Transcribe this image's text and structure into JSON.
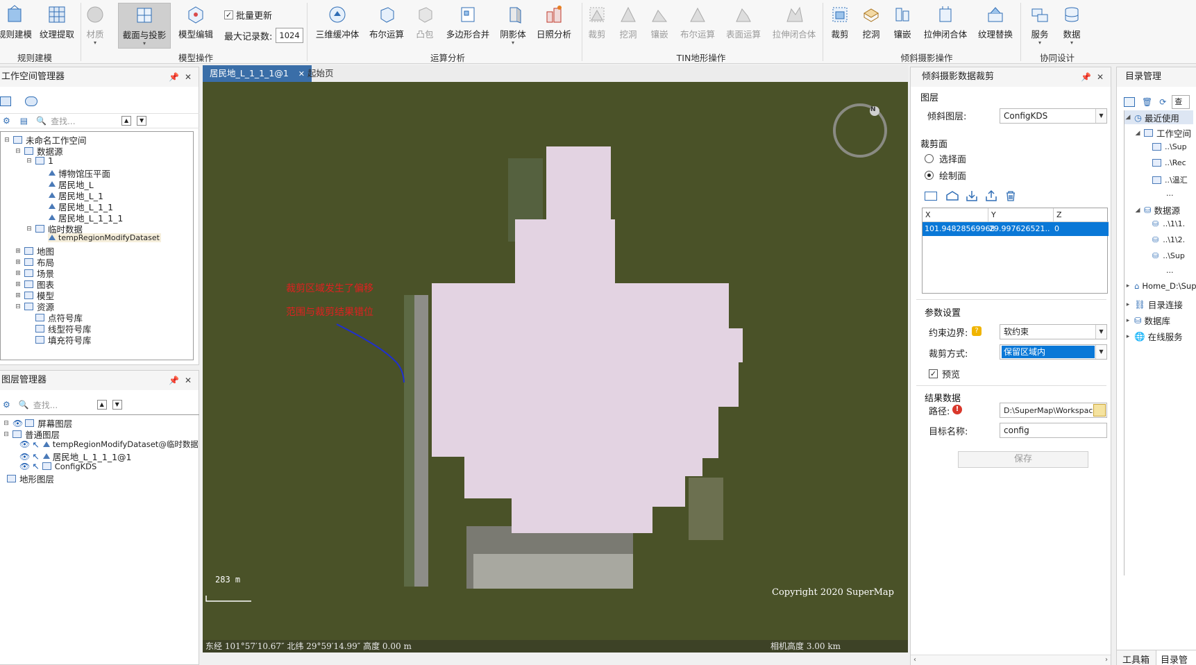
{
  "ribbon": {
    "buttons": [
      {
        "id": "rule-model",
        "label": "规则建模",
        "dropdown": false,
        "disabled": false,
        "icon": "building-icon"
      },
      {
        "id": "texture-extract",
        "label": "纹理提取",
        "dropdown": false,
        "disabled": false,
        "icon": "texture-icon"
      },
      {
        "id": "material",
        "label": "材质",
        "dropdown": true,
        "disabled": true,
        "icon": "sphere-icon"
      },
      {
        "id": "section-projection",
        "label": "截面与投影",
        "dropdown": true,
        "disabled": false,
        "icon": "section-icon"
      },
      {
        "id": "model-edit",
        "label": "模型编辑",
        "dropdown": false,
        "disabled": false,
        "icon": "model-edit-icon"
      },
      {
        "id": "buffer3d",
        "label": "三维缓冲体",
        "dropdown": false,
        "disabled": false,
        "icon": "buffer-icon"
      },
      {
        "id": "boolean",
        "label": "布尔运算",
        "dropdown": false,
        "disabled": false,
        "icon": "boolean-icon"
      },
      {
        "id": "convex",
        "label": "凸包",
        "dropdown": false,
        "disabled": true,
        "icon": "convex-icon"
      },
      {
        "id": "polygon-merge",
        "label": "多边形合并",
        "dropdown": false,
        "disabled": false,
        "icon": "polygon-merge-icon"
      },
      {
        "id": "shadow",
        "label": "阴影体",
        "dropdown": true,
        "disabled": false,
        "icon": "shadow-icon"
      },
      {
        "id": "sunlight",
        "label": "日照分析",
        "dropdown": false,
        "disabled": false,
        "icon": "sunlight-icon"
      },
      {
        "id": "tin-clip",
        "label": "裁剪",
        "dropdown": false,
        "disabled": true,
        "icon": "tin-clip-icon"
      },
      {
        "id": "tin-dig",
        "label": "挖洞",
        "dropdown": false,
        "disabled": true,
        "icon": "tin-dig-icon"
      },
      {
        "id": "tin-inlay",
        "label": "镶嵌",
        "dropdown": false,
        "disabled": true,
        "icon": "tin-inlay-icon"
      },
      {
        "id": "tin-boolean",
        "label": "布尔运算",
        "dropdown": false,
        "disabled": true,
        "icon": "tin-boolean-icon"
      },
      {
        "id": "tin-surface",
        "label": "表面运算",
        "dropdown": false,
        "disabled": true,
        "icon": "tin-surface-icon"
      },
      {
        "id": "tin-extrude",
        "label": "拉伸闭合体",
        "dropdown": false,
        "disabled": true,
        "icon": "tin-extrude-icon"
      },
      {
        "id": "oblique-clip",
        "label": "裁剪",
        "dropdown": false,
        "disabled": false,
        "icon": "oblique-clip-icon"
      },
      {
        "id": "oblique-dig",
        "label": "挖洞",
        "dropdown": false,
        "disabled": false,
        "icon": "oblique-dig-icon"
      },
      {
        "id": "oblique-inlay",
        "label": "镶嵌",
        "dropdown": false,
        "disabled": false,
        "icon": "oblique-inlay-icon"
      },
      {
        "id": "oblique-extrude",
        "label": "拉伸闭合体",
        "dropdown": false,
        "disabled": false,
        "icon": "oblique-extrude-icon"
      },
      {
        "id": "texture-replace",
        "label": "纹理替换",
        "dropdown": false,
        "disabled": false,
        "icon": "texture-replace-icon"
      },
      {
        "id": "service",
        "label": "服务",
        "dropdown": true,
        "disabled": false,
        "icon": "service-icon"
      },
      {
        "id": "data",
        "label": "数据",
        "dropdown": true,
        "disabled": false,
        "icon": "database-icon"
      }
    ],
    "batch_update_label": "批量更新",
    "batch_update_checked": true,
    "max_records_label": "最大记录数:",
    "max_records_value": "1024",
    "groups": [
      "规则建模",
      "模型操作",
      "运算分析",
      "TIN地形操作",
      "倾斜摄影操作",
      "协同设计"
    ]
  },
  "workspace": {
    "title": "工作空间管理器",
    "search_placeholder": "查找...",
    "tree": [
      {
        "label": "未命名工作空间",
        "level": 0,
        "icon": "workspace-icon"
      },
      {
        "label": "数据源",
        "level": 1,
        "icon": "datasource-icon"
      },
      {
        "label": "1",
        "level": 2,
        "icon": "udb-icon"
      },
      {
        "label": "博物馆压平面",
        "level": 3,
        "icon": "region-icon"
      },
      {
        "label": "居民地_L",
        "level": 3,
        "icon": "line-icon"
      },
      {
        "label": "居民地_L_1",
        "level": 3,
        "icon": "region-icon"
      },
      {
        "label": "居民地_L_1_1",
        "level": 3,
        "icon": "region-icon"
      },
      {
        "label": "居民地_L_1_1_1",
        "level": 3,
        "icon": "region-icon"
      },
      {
        "label": "临时数据",
        "level": 2,
        "icon": "memory-icon"
      },
      {
        "label": "tempRegionModifyDataset",
        "level": 3,
        "icon": "region-icon"
      },
      {
        "label": "地图",
        "level": 1,
        "icon": "map-icon"
      },
      {
        "label": "布局",
        "level": 1,
        "icon": "layout-icon"
      },
      {
        "label": "场景",
        "level": 1,
        "icon": "scene-icon"
      },
      {
        "label": "图表",
        "level": 1,
        "icon": "chart-icon"
      },
      {
        "label": "模型",
        "level": 1,
        "icon": "model-icon"
      },
      {
        "label": "资源",
        "level": 1,
        "icon": "resource-icon"
      },
      {
        "label": "点符号库",
        "level": 2,
        "icon": "point-symbol-icon"
      },
      {
        "label": "线型符号库",
        "level": 2,
        "icon": "line-symbol-icon"
      },
      {
        "label": "填充符号库",
        "level": 2,
        "icon": "fill-symbol-icon"
      }
    ]
  },
  "layers": {
    "title": "图层管理器",
    "search_placeholder": "查找...",
    "tree": [
      {
        "label": "屏幕图层",
        "level": 0
      },
      {
        "label": "普通图层",
        "level": 0
      },
      {
        "label": "tempRegionModifyDataset@临时数据",
        "level": 1
      },
      {
        "label": "居民地_L_1_1_1@1",
        "level": 1
      },
      {
        "label": "ConfigKDS",
        "level": 1
      },
      {
        "label": "地形图层",
        "level": 0
      }
    ]
  },
  "map": {
    "tabs": [
      "居民地_L_1_1_1@1",
      "起始页"
    ],
    "annotation_1": "裁剪区域发生了偏移",
    "annotation_2": "范围与裁剪结果错位",
    "scale_text": "283 m",
    "copyright": "Copyright 2020 SuperMap",
    "status_coords": "东经 101°57′10.67″  北纬 29°59′14.99″  高度 0.00 m",
    "camera_height": "相机高度 3.00 km",
    "compass_letter": "N",
    "colors": {
      "ground": "#4a5228",
      "clip_region": "#e3d3e2",
      "annotation": "#e02020",
      "arrow": "#1f2fd0"
    }
  },
  "clip_panel": {
    "title": "倾斜摄影数据裁剪",
    "layer_section": "图层",
    "oblique_layer_label": "倾斜图层:",
    "oblique_layer_value": "ConfigKDS",
    "clip_face_section": "裁剪面",
    "radio_select": "选择面",
    "radio_draw": "绘制面",
    "radio_selected": "绘制面",
    "table_headers": [
      "X",
      "Y",
      "Z"
    ],
    "table_rows": [
      [
        "101.94828569968",
        "29.997626521...",
        "0"
      ]
    ],
    "params_section": "参数设置",
    "constraint_label": "约束边界:",
    "constraint_value": "软约束",
    "clip_mode_label": "裁剪方式:",
    "clip_mode_value": "保留区域内",
    "preview_label": "预览",
    "preview_checked": true,
    "result_section": "结果数据",
    "path_label": "路径:",
    "path_value": "D:\\SuperMap\\Workspace",
    "target_label": "目标名称:",
    "target_value": "config",
    "save_label": "保存"
  },
  "catalog": {
    "title": "目录管理",
    "search_label": "查",
    "tree": [
      {
        "label": "最近使用",
        "level": 0,
        "selected": true
      },
      {
        "label": "工作空间",
        "level": 1
      },
      {
        "label": "..\\Sup",
        "level": 2
      },
      {
        "label": "..\\Rec",
        "level": 2
      },
      {
        "label": "..\\温汇",
        "level": 2
      },
      {
        "label": "...",
        "level": 2
      },
      {
        "label": "数据源",
        "level": 1
      },
      {
        "label": "..\\1\\1.",
        "level": 2
      },
      {
        "label": "..\\1\\2.",
        "level": 2
      },
      {
        "label": "..\\Sup",
        "level": 2
      },
      {
        "label": "...",
        "level": 2
      },
      {
        "label": "Home_D:\\Sup",
        "level": 0
      },
      {
        "label": "目录连接",
        "level": 0
      },
      {
        "label": "数据库",
        "level": 0
      },
      {
        "label": "在线服务",
        "level": 0
      }
    ],
    "bottom_tabs": [
      "工具箱",
      "目录管理"
    ]
  }
}
